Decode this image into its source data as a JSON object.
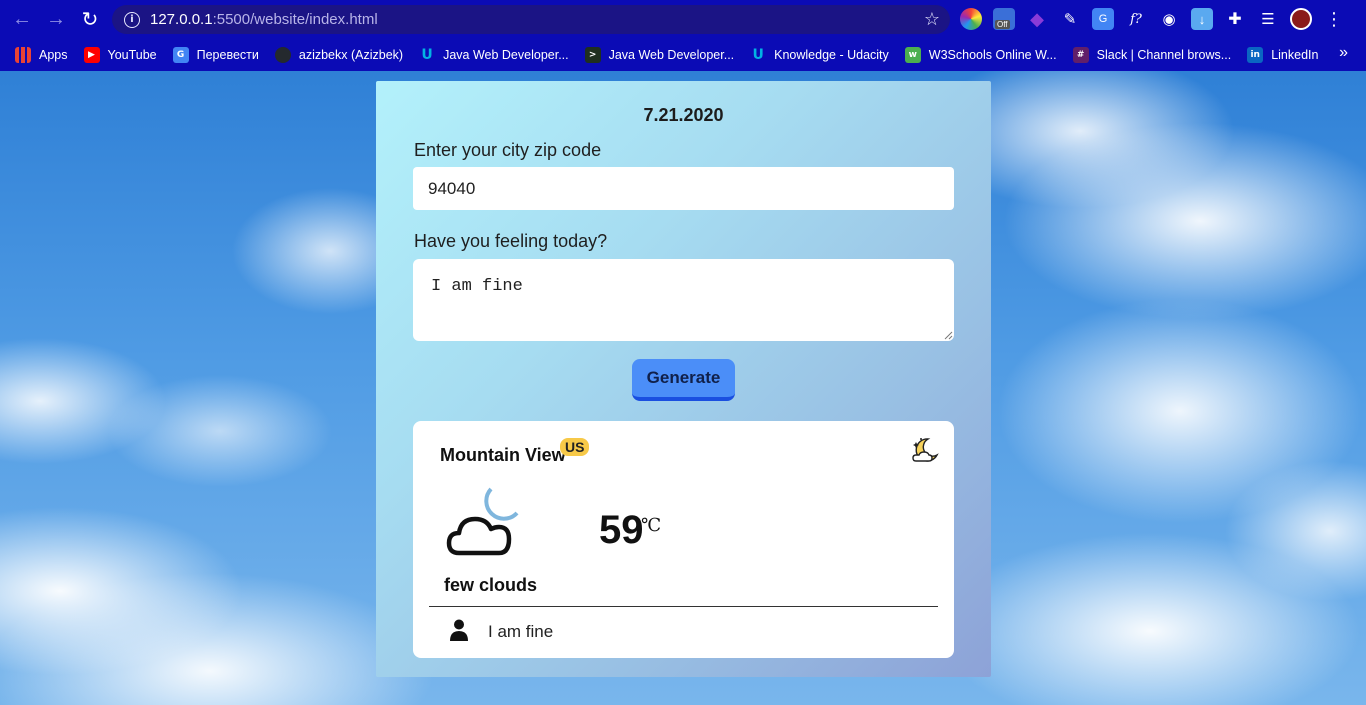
{
  "browser": {
    "url_host": "127.0.0.1",
    "url_path": ":5500/website/index.html",
    "nav": {
      "back_icon": "back-arrow-icon",
      "forward_icon": "forward-arrow-icon",
      "reload_icon": "reload-icon"
    },
    "extension_badge": "Off",
    "bookmarks": [
      {
        "label": "Apps",
        "icon": "apps-grid-icon",
        "color": "#e94235"
      },
      {
        "label": "YouTube",
        "icon": "youtube-icon",
        "color": "#ff0000"
      },
      {
        "label": "Перевести",
        "icon": "google-translate-icon",
        "color": "#4285f4"
      },
      {
        "label": "azizbekx (Azizbek)",
        "icon": "github-icon",
        "color": "#24292e"
      },
      {
        "label": "Java Web Developer...",
        "icon": "udacity-icon",
        "color": "#02b3e4"
      },
      {
        "label": "Java Web Developer...",
        "icon": "terminal-icon",
        "color": "#1f2f1f"
      },
      {
        "label": "Knowledge - Udacity",
        "icon": "udacity-icon",
        "color": "#02b3e4"
      },
      {
        "label": "W3Schools Online W...",
        "icon": "w3schools-icon",
        "color": "#4caf50"
      },
      {
        "label": "Slack | Channel brows...",
        "icon": "slack-icon",
        "color": "#611f69"
      },
      {
        "label": "LinkedIn",
        "icon": "linkedin-icon",
        "color": "#0a66c2"
      }
    ]
  },
  "app": {
    "date": "7.21.2020",
    "zip_label": "Enter your city zip code",
    "zip_value": "94040",
    "feeling_label": "Have you feeling today?",
    "feeling_value": "I am fine",
    "generate_label": "Generate",
    "result": {
      "city": "Mountain View",
      "country": "US",
      "temperature": "59",
      "unit": "℃",
      "description": "few clouds",
      "feeling": "I am fine",
      "weather_icon": "cloud-moon-icon",
      "time_icon": "moon-stars-icon",
      "user_icon": "user-icon"
    }
  }
}
